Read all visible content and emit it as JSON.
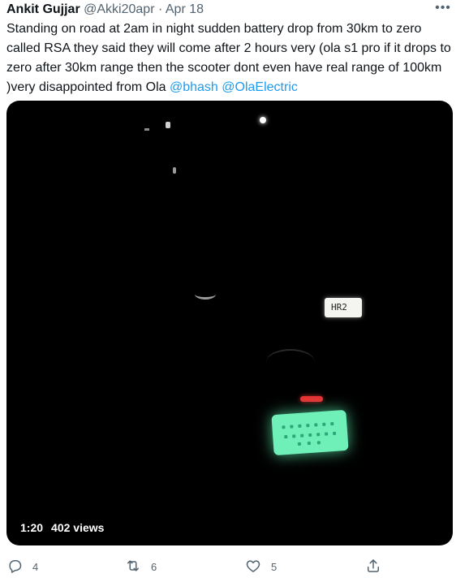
{
  "tweet": {
    "author_name": "Ankit Gujjar",
    "author_handle": "@Akki20apr",
    "separator": "·",
    "date": "Apr 18",
    "more_label": "•••",
    "text_main": "Standing on road at 2am in night sudden battery drop from 30km to zero called RSA they said they will come after 2 hours very (ola s1 pro if it drops to zero after 30km range then the scooter dont even have real range of 100km )very disappointed from Ola ",
    "mention_1": "@bhash",
    "mention_2": "@OlaElectric"
  },
  "media": {
    "plate_text": "HR2",
    "duration": "1:20",
    "views": "402 views"
  },
  "actions": {
    "reply_count": "4",
    "retweet_count": "6",
    "like_count": "5"
  },
  "icons": {
    "reply": "reply-icon",
    "retweet": "retweet-icon",
    "like": "heart-icon",
    "share": "share-icon",
    "more": "more-icon"
  },
  "colors": {
    "text": "#0f1419",
    "secondary": "#536471",
    "link": "#1d9bf0"
  }
}
